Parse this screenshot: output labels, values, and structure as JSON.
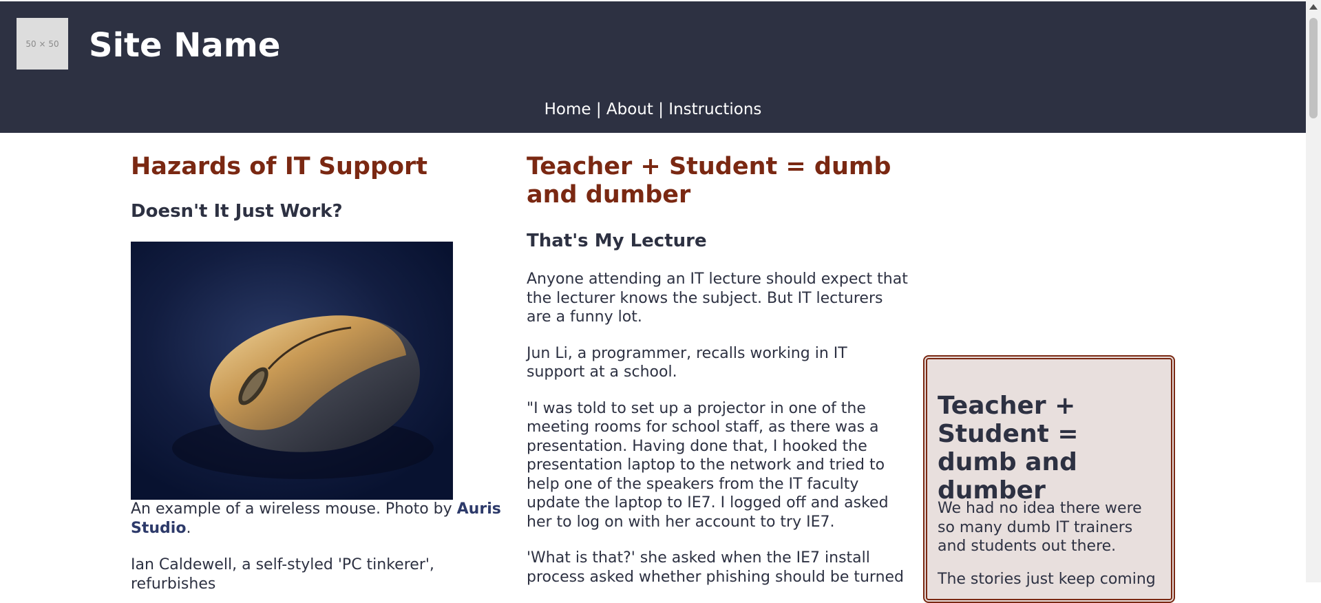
{
  "header": {
    "logo_text": "50 × 50",
    "site_name": "Site Name",
    "nav": [
      "Home",
      "About",
      "Instructions"
    ],
    "separator": "|"
  },
  "left": {
    "title": "Hazards of IT Support",
    "subtitle": "Doesn't It Just Work?",
    "caption_text": "An example of a wireless mouse. Photo by ",
    "caption_credit": "Auris Studio",
    "caption_end": ".",
    "paragraph": "Ian Caldewell, a self-styled 'PC tinkerer', refurbishes"
  },
  "middle": {
    "title": "Teacher + Student = dumb and dumber",
    "subtitle": "That's My Lecture",
    "paragraphs": [
      "Anyone attending an IT lecture should expect that the lecturer knows the subject. But IT lecturers are a funny lot.",
      "Jun Li, a programmer, recalls working in IT support at a school.",
      "\"I was told to set up a projector in one of the meeting rooms for school staff, as there was a presentation. Having done that, I hooked the presentation laptop to the network and tried to help one of the speakers from the IT faculty update the laptop to IE7. I logged off and asked her to log on with her account to try IE7.",
      "'What is that?' she asked when the IE7 install process asked whether phishing should be turned"
    ]
  },
  "sidebar": {
    "title": "Teacher + Student = dumb and dumber",
    "paragraphs": [
      "We had no idea there were so many dumb IT trainers and students out there.",
      "The stories just keep coming"
    ]
  },
  "colors": {
    "header_bg": "#2d3142",
    "heading_red": "#7a2812",
    "text": "#2d3142",
    "sidebar_bg": "#e8dfdd"
  }
}
